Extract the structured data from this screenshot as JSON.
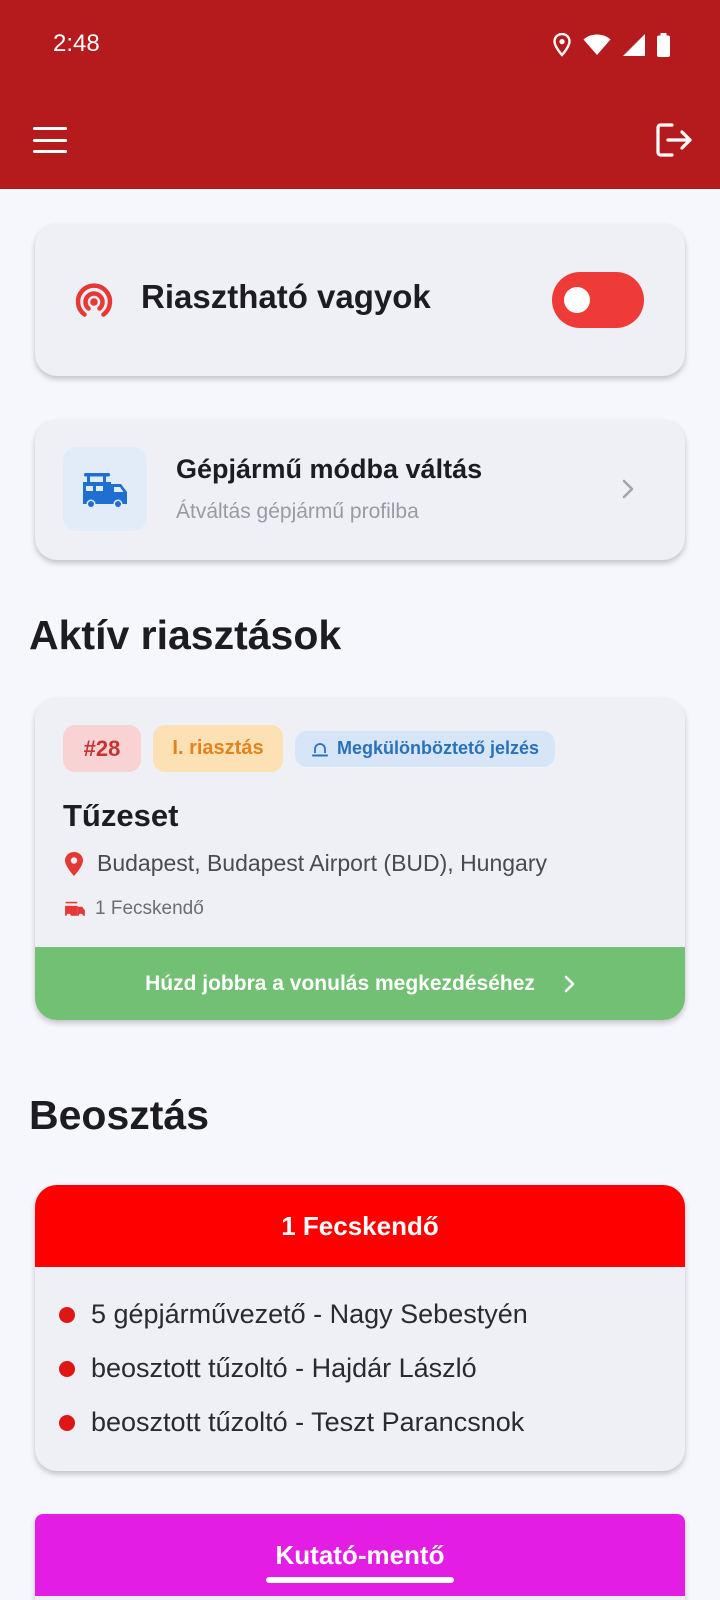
{
  "status_bar": {
    "time": "2:48"
  },
  "app_bar": {
    "menu_icon": "hamburger-menu-icon",
    "logout_icon": "logout-icon",
    "color": "#b51b1c"
  },
  "alarm_toggle": {
    "label": "Riasztható vagyok",
    "icon": "broadcast-icon",
    "enabled": true,
    "toggle_color": "#ef3b37"
  },
  "vehicle_mode": {
    "title": "Gépjármű módba váltás",
    "subtitle": "Átváltás gépjármű profilba",
    "icon": "fire-truck-icon"
  },
  "active_alarms": {
    "heading": "Aktív riasztások",
    "incidents": [
      {
        "id_badge": "#28",
        "level_badge": "I. riasztás",
        "signal_badge": "Megkülönböztető jelzés",
        "title": "Tűzeset",
        "address": "Budapest, Budapest Airport (BUD), Hungary",
        "unit": "1 Fecskendő",
        "swipe_label": "Húzd jobbra a vonulás megkezdéséhez"
      }
    ]
  },
  "roster": {
    "heading": "Beosztás",
    "groups": [
      {
        "name": "1 Fecskendő",
        "color": "#fe0000",
        "members": [
          "5 gépjárművezető - Nagy Sebestyén",
          "beosztott tűzoltó - Hajdár László",
          "beosztott tűzoltó - Teszt Parancsnok"
        ]
      },
      {
        "name": "Kutató-mentő",
        "color": "#e31de3"
      }
    ]
  }
}
